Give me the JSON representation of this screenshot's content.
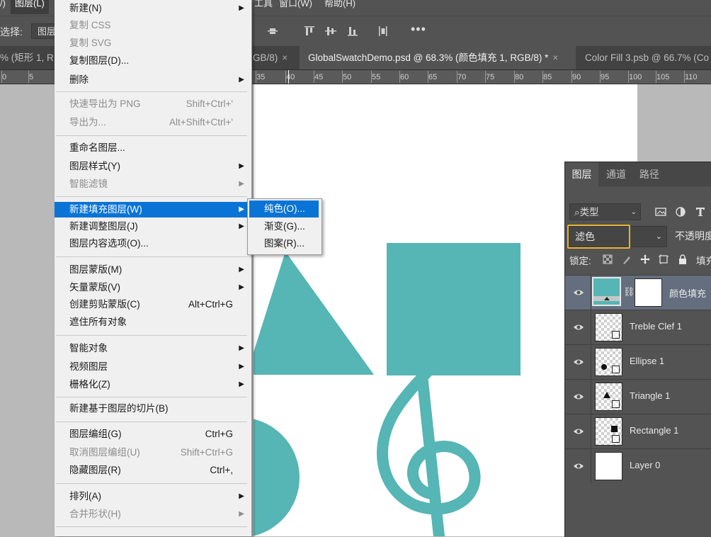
{
  "menubar": {
    "items": [
      "/)",
      "图层(L)",
      "工具",
      "窗口(W)",
      "帮助(H)"
    ]
  },
  "options": {
    "select_label": "选择:",
    "select_value": "图层",
    "more": "•••"
  },
  "tabs": [
    {
      "label": "% (矩形 1, R",
      "active": false
    },
    {
      "label": "GB/8)",
      "active": false
    },
    {
      "label": "GlobalSwatchDemo.psd @ 68.3% (颜色填充 1, RGB/8) *",
      "active": true
    },
    {
      "label": "Color Fill 3.psb @ 66.7% (Co",
      "active": false
    }
  ],
  "tab_close": "×",
  "ruler": {
    "labels": [
      "0",
      "5",
      "35",
      "40",
      "45",
      "50",
      "55",
      "60",
      "65",
      "70",
      "75",
      "80",
      "85",
      "90",
      "95",
      "100",
      "105",
      "110"
    ]
  },
  "layer_menu": {
    "items": [
      {
        "label": "新建(N)",
        "shortcut": "",
        "submenu": true,
        "disabled": false
      },
      {
        "label": "复制 CSS",
        "shortcut": "",
        "submenu": false,
        "disabled": true
      },
      {
        "label": "复制 SVG",
        "shortcut": "",
        "submenu": false,
        "disabled": true
      },
      {
        "label": "复制图层(D)...",
        "shortcut": "",
        "submenu": false,
        "disabled": false
      },
      {
        "label": "删除",
        "shortcut": "",
        "submenu": true,
        "disabled": false
      },
      {
        "label": "快速导出为 PNG",
        "shortcut": "Shift+Ctrl+'",
        "submenu": false,
        "disabled": true
      },
      {
        "label": "导出为...",
        "shortcut": "Alt+Shift+Ctrl+'",
        "submenu": false,
        "disabled": true
      },
      {
        "label": "重命名图层...",
        "shortcut": "",
        "submenu": false,
        "disabled": false
      },
      {
        "label": "图层样式(Y)",
        "shortcut": "",
        "submenu": true,
        "disabled": false
      },
      {
        "label": "智能滤镜",
        "shortcut": "",
        "submenu": true,
        "disabled": true
      },
      {
        "label": "新建填充图层(W)",
        "shortcut": "",
        "submenu": true,
        "disabled": false,
        "highlight": true
      },
      {
        "label": "新建调整图层(J)",
        "shortcut": "",
        "submenu": true,
        "disabled": false
      },
      {
        "label": "图层内容选项(O)...",
        "shortcut": "",
        "submenu": false,
        "disabled": false
      },
      {
        "label": "图层蒙版(M)",
        "shortcut": "",
        "submenu": true,
        "disabled": false
      },
      {
        "label": "矢量蒙版(V)",
        "shortcut": "",
        "submenu": true,
        "disabled": false
      },
      {
        "label": "创建剪贴蒙版(C)",
        "shortcut": "Alt+Ctrl+G",
        "submenu": false,
        "disabled": false
      },
      {
        "label": "遮住所有对象",
        "shortcut": "",
        "submenu": false,
        "disabled": false
      },
      {
        "label": "智能对象",
        "shortcut": "",
        "submenu": true,
        "disabled": false
      },
      {
        "label": "视频图层",
        "shortcut": "",
        "submenu": true,
        "disabled": false
      },
      {
        "label": "栅格化(Z)",
        "shortcut": "",
        "submenu": true,
        "disabled": false
      },
      {
        "label": "新建基于图层的切片(B)",
        "shortcut": "",
        "submenu": false,
        "disabled": false
      },
      {
        "label": "图层编组(G)",
        "shortcut": "Ctrl+G",
        "submenu": false,
        "disabled": false
      },
      {
        "label": "取消图层编组(U)",
        "shortcut": "Shift+Ctrl+G",
        "submenu": false,
        "disabled": true
      },
      {
        "label": "隐藏图层(R)",
        "shortcut": "Ctrl+,",
        "submenu": false,
        "disabled": false
      },
      {
        "label": "排列(A)",
        "shortcut": "",
        "submenu": true,
        "disabled": false
      },
      {
        "label": "合并形状(H)",
        "shortcut": "",
        "submenu": true,
        "disabled": true
      }
    ]
  },
  "fill_submenu": {
    "items": [
      {
        "label": "纯色(O)...",
        "highlight": true
      },
      {
        "label": "渐变(G)...",
        "highlight": false
      },
      {
        "label": "图案(R)...",
        "highlight": false
      }
    ]
  },
  "layers_panel": {
    "tabs": [
      "图层",
      "通道",
      "路径"
    ],
    "filter_label": "类型",
    "blend_mode": "滤色",
    "opacity_label": "不透明度",
    "lock_label": "锁定:",
    "fill_label": "填充",
    "layers": [
      {
        "name": "颜色填充",
        "selected": true
      },
      {
        "name": "Treble Clef 1",
        "selected": false
      },
      {
        "name": "Ellipse 1",
        "selected": false
      },
      {
        "name": "Triangle 1",
        "selected": false
      },
      {
        "name": "Rectangle 1",
        "selected": false
      },
      {
        "name": "Layer 0",
        "selected": false
      }
    ]
  },
  "colors": {
    "accent": "#0a74d6",
    "shape_fill": "#56b5b5",
    "highlight_box": "#e6b530"
  }
}
